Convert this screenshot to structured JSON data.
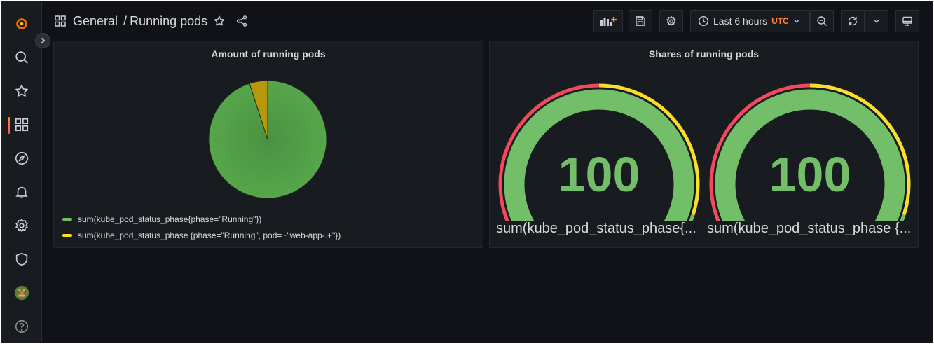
{
  "breadcrumb": {
    "folder": "General",
    "separator": "/",
    "dashboard": "Running pods"
  },
  "toolbar": {
    "time_range": "Last 6 hours",
    "timezone": "UTC",
    "buttons": [
      "add-panel-icon",
      "save-icon",
      "settings-icon",
      "clock-icon",
      "zoom-out-icon",
      "refresh-icon",
      "chevron-down-icon",
      "tv-icon"
    ]
  },
  "sidebar": {
    "items": [
      "grafana-logo",
      "search-icon",
      "star-icon",
      "dashboards-icon",
      "explore-icon",
      "alerting-icon",
      "configuration-icon",
      "shield-icon",
      "avatar",
      "help-icon"
    ],
    "active": "dashboards-icon"
  },
  "panels": {
    "pie": {
      "title": "Amount of running pods",
      "legend": [
        {
          "label": "sum(kube_pod_status_phase{phase=\"Running\"})",
          "color": "#73bf69"
        },
        {
          "label": "sum(kube_pod_status_phase {phase=\"Running\", pod=~\"web-app-.+\"})",
          "color": "#fade2a"
        }
      ]
    },
    "gauges": {
      "title": "Shares of running pods",
      "items": [
        {
          "value": "100",
          "label": "sum(kube_pod_status_phase{..."
        },
        {
          "value": "100",
          "label": "sum(kube_pod_status_phase {..."
        }
      ]
    }
  },
  "colors": {
    "background": "#111217",
    "panel": "#181b1f",
    "green": "#73bf69",
    "dark_green": "#56a64b",
    "yellow": "#fade2a",
    "dark_yellow": "#b8970a",
    "red": "#f2495c",
    "accent": "#ff8833"
  },
  "chart_data": [
    {
      "type": "pie",
      "series": [
        {
          "name": "sum(kube_pod_status_phase{phase=\"Running\"})",
          "value": 95
        },
        {
          "name": "sum(kube_pod_status_phase {phase=\"Running\", pod=~\"web-app-.+\"})",
          "value": 5
        }
      ],
      "legend": "bottom-left"
    },
    {
      "type": "gauge",
      "values": [
        100,
        100
      ],
      "thresholds": [
        {
          "color": "#f2495c",
          "from": 0,
          "to": 50
        },
        {
          "color": "#fade2a",
          "from": 50,
          "to": 90
        },
        {
          "color": "#73bf69",
          "from": 90,
          "to": 100
        }
      ]
    }
  ]
}
